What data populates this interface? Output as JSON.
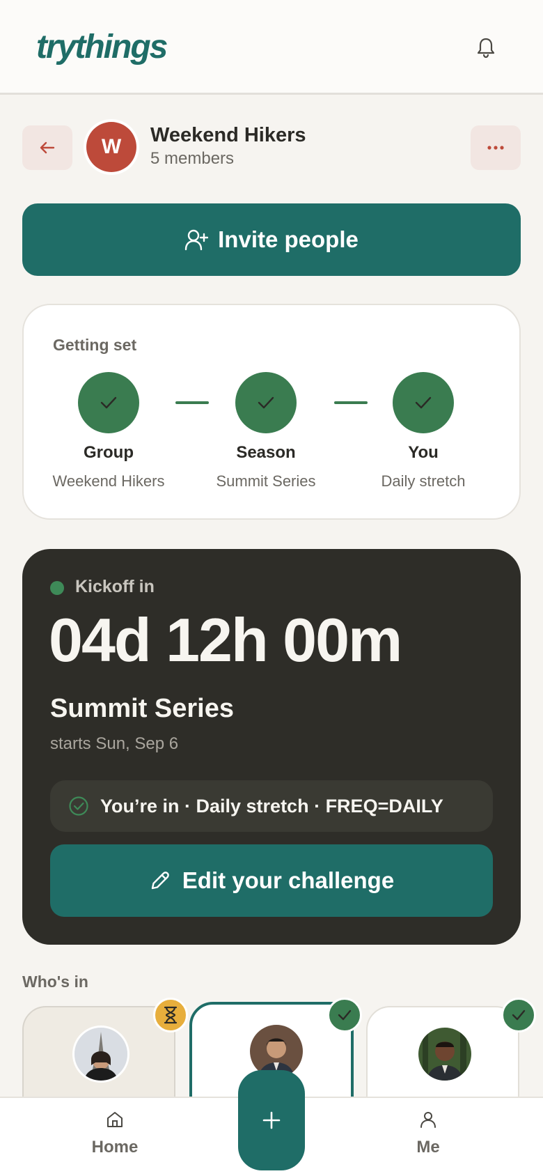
{
  "header": {
    "logo": "trythings",
    "bell_icon": "bell-icon"
  },
  "group": {
    "avatar_letter": "W",
    "avatar_color": "#bd4a3a",
    "name": "Weekend Hikers",
    "members": "5 members"
  },
  "invite": {
    "label": "Invite people",
    "icon": "user-plus-icon"
  },
  "setup": {
    "title": "Getting set",
    "steps": [
      {
        "label": "Group",
        "sub": "Weekend Hikers",
        "done": true
      },
      {
        "label": "Season",
        "sub": "Summit Series",
        "done": true
      },
      {
        "label": "You",
        "sub": "Daily stretch",
        "done": true
      }
    ]
  },
  "kickoff": {
    "label": "Kickoff in",
    "countdown": "04d 12h 00m",
    "season_name": "Summit Series",
    "starts": "starts Sun, Sep 6",
    "status": "You’re in · Daily stretch · FREQ=DAILY",
    "edit_label": "Edit your challenge"
  },
  "whos_in": {
    "title": "Who's in",
    "members": [
      {
        "status": "pending",
        "badge_icon": "hourglass-icon"
      },
      {
        "status": "joined",
        "is_me": true,
        "badge_icon": "check-icon"
      },
      {
        "status": "joined",
        "badge_icon": "check-icon"
      }
    ]
  },
  "nav": {
    "home": "Home",
    "me": "Me",
    "fab_icon": "plus-icon"
  },
  "colors": {
    "brand": "#1f6d67",
    "success": "#3a7c50",
    "dark_card": "#2e2d28",
    "background": "#f6f4f0"
  }
}
